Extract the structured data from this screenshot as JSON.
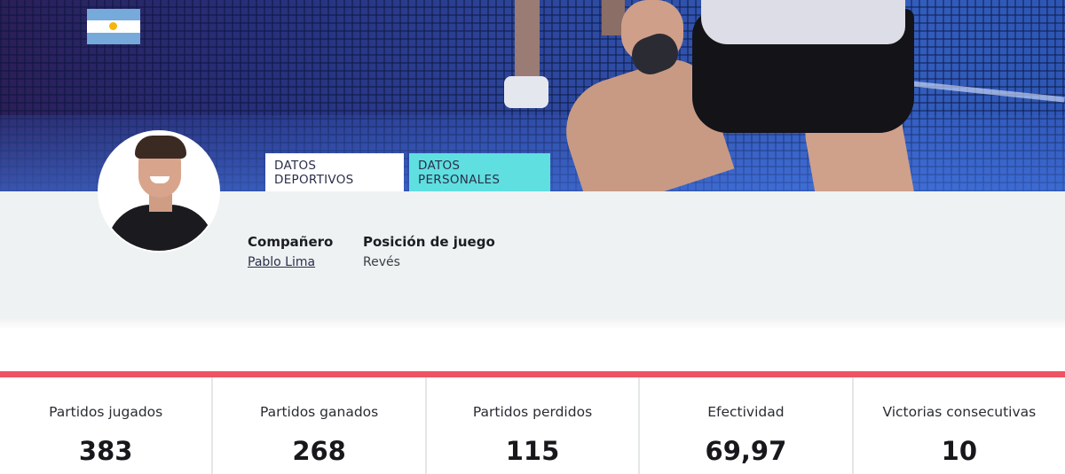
{
  "tabs": {
    "sport": "DATOS DEPORTIVOS",
    "personal": "DATOS PERSONALES"
  },
  "player": {
    "country_flag": "argentina-flag-icon",
    "partner_label": "Compañero",
    "partner_name": "Pablo Lima",
    "position_label": "Posición de juego",
    "position_value": "Revés"
  },
  "stats": [
    {
      "label": "Partidos jugados",
      "value": "383"
    },
    {
      "label": "Partidos ganados",
      "value": "268"
    },
    {
      "label": "Partidos perdidos",
      "value": "115"
    },
    {
      "label": "Efectividad",
      "value": "69,97"
    },
    {
      "label": "Victorias consecutivas",
      "value": "10"
    }
  ],
  "colors": {
    "accent_red": "#ee5364",
    "tab_active": "#5fdfe0",
    "panel_bg": "#eef2f3"
  }
}
